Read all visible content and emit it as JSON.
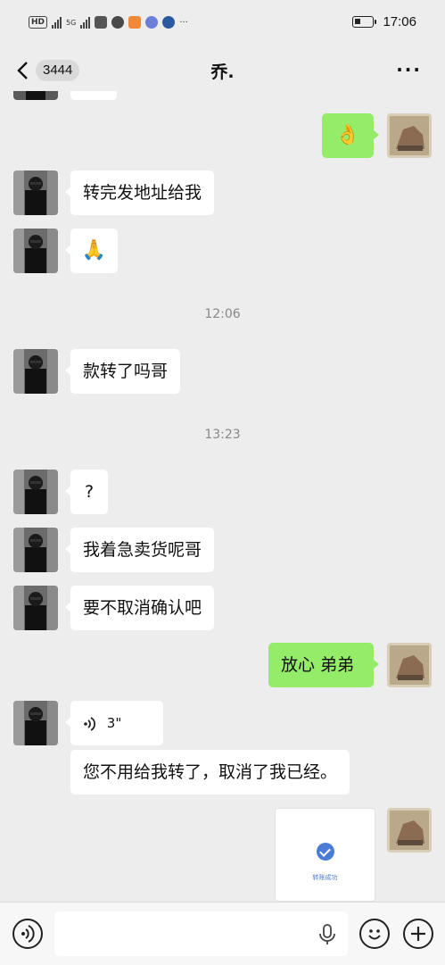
{
  "status_bar": {
    "network": "HD",
    "signal_1": "",
    "signal_2": "5G",
    "more": "···",
    "time": "17:06"
  },
  "nav": {
    "back_badge": "3444",
    "title": "乔.",
    "more": "···"
  },
  "messages": [
    {
      "side": "right",
      "type": "emoji",
      "text": "👌"
    },
    {
      "side": "left",
      "type": "text",
      "text": "转完发地址给我"
    },
    {
      "side": "left",
      "type": "emoji",
      "text": "🙏"
    },
    {
      "side": "left",
      "type": "text",
      "text": "款转了吗哥"
    },
    {
      "side": "left",
      "type": "text",
      "text": "?"
    },
    {
      "side": "left",
      "type": "text",
      "text": "我着急卖货呢哥"
    },
    {
      "side": "left",
      "type": "text",
      "text": "要不取消确认吧"
    },
    {
      "side": "right",
      "type": "text",
      "text": "放心 弟弟"
    },
    {
      "side": "left",
      "type": "voice",
      "text": "3\""
    },
    {
      "side": "left",
      "type": "text",
      "text": "您不用给我转了，取消了我已经。"
    },
    {
      "side": "right",
      "type": "image",
      "text": ""
    }
  ],
  "timestamps": [
    "12:06",
    "13:23"
  ],
  "transfer_card": {
    "status": "转账成功",
    "header_left": "",
    "header_right": "",
    "link": "",
    "row_label": "",
    "row_value": ""
  },
  "input_bar": {
    "placeholder": "",
    "voice_icon": "voice-toggle-icon",
    "emoji_icon": "emoji-icon",
    "plus_icon": "plus-icon"
  },
  "colors": {
    "background": "#ededed",
    "sent_bubble": "#95ec69",
    "received_bubble": "#ffffff",
    "accent_blue": "#4a7cd6"
  }
}
